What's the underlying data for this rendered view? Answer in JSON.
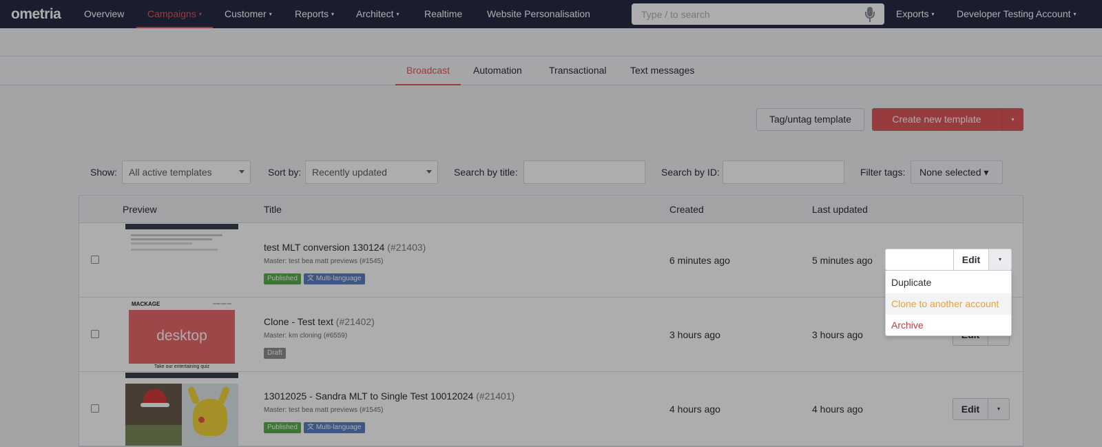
{
  "nav": {
    "logo": "ometria",
    "items": [
      {
        "label": "Overview",
        "caret": false
      },
      {
        "label": "Campaigns",
        "caret": true,
        "active": true
      },
      {
        "label": "Customer",
        "caret": true
      },
      {
        "label": "Reports",
        "caret": true
      },
      {
        "label": "Architect",
        "caret": true
      },
      {
        "label": "Realtime",
        "caret": false
      },
      {
        "label": "Website Personalisation",
        "caret": false
      }
    ],
    "search_placeholder": "Type / to search",
    "exports": "Exports",
    "account": "Developer Testing Account",
    "caret": "▾"
  },
  "subtabs": [
    {
      "label": "Broadcast",
      "active": true
    },
    {
      "label": "Automation"
    },
    {
      "label": "Transactional"
    },
    {
      "label": "Text messages"
    }
  ],
  "actions": {
    "tag": "Tag/untag template",
    "create": "Create new template",
    "caret": "▾"
  },
  "filters": {
    "show_label": "Show:",
    "show_value": "All active templates",
    "sort_label": "Sort by:",
    "sort_value": "Recently updated",
    "title_label": "Search by title:",
    "id_label": "Search by ID:",
    "tags_label": "Filter tags:",
    "tags_value": "None selected ▾"
  },
  "table": {
    "headers": {
      "preview": "Preview",
      "title": "Title",
      "created": "Created",
      "updated": "Last updated"
    },
    "rows": [
      {
        "title": "test MLT conversion 130124",
        "id": "(#21403)",
        "master": "Master: test bea matt previews (#1545)",
        "badges": [
          "Published",
          "Multi-language"
        ],
        "created": "6 minutes ago",
        "updated": "5 minutes ago",
        "edit": "Edit"
      },
      {
        "title": "Clone - Test text",
        "id": "(#21402)",
        "master": "Master: km cloning (#6559)",
        "badges": [
          "Draft"
        ],
        "created": "3 hours ago",
        "updated": "3 hours ago",
        "edit": "Edit",
        "thumb_logo": "MACKAGE",
        "thumb_nav": "WOMEN   MEN   KIDS",
        "thumb_hero": "desktop",
        "thumb_caption": "Take our entertaining quiz"
      },
      {
        "title": "13012025 - Sandra MLT to Single Test 10012024",
        "id": "(#21401)",
        "master": "Master: test bea matt previews (#1545)",
        "badges": [
          "Published",
          "Multi-language"
        ],
        "created": "4 hours ago",
        "updated": "4 hours ago",
        "edit": "Edit"
      }
    ]
  },
  "dropdown": {
    "edit": "Edit",
    "caret": "▾",
    "items": [
      "Duplicate",
      "Clone to another account",
      "Archive"
    ],
    "colors": {
      "highlight": "#f0a030",
      "danger": "#c9383c"
    }
  },
  "colors": {
    "brand": "#e1585c",
    "nav_bg": "#262b44"
  }
}
